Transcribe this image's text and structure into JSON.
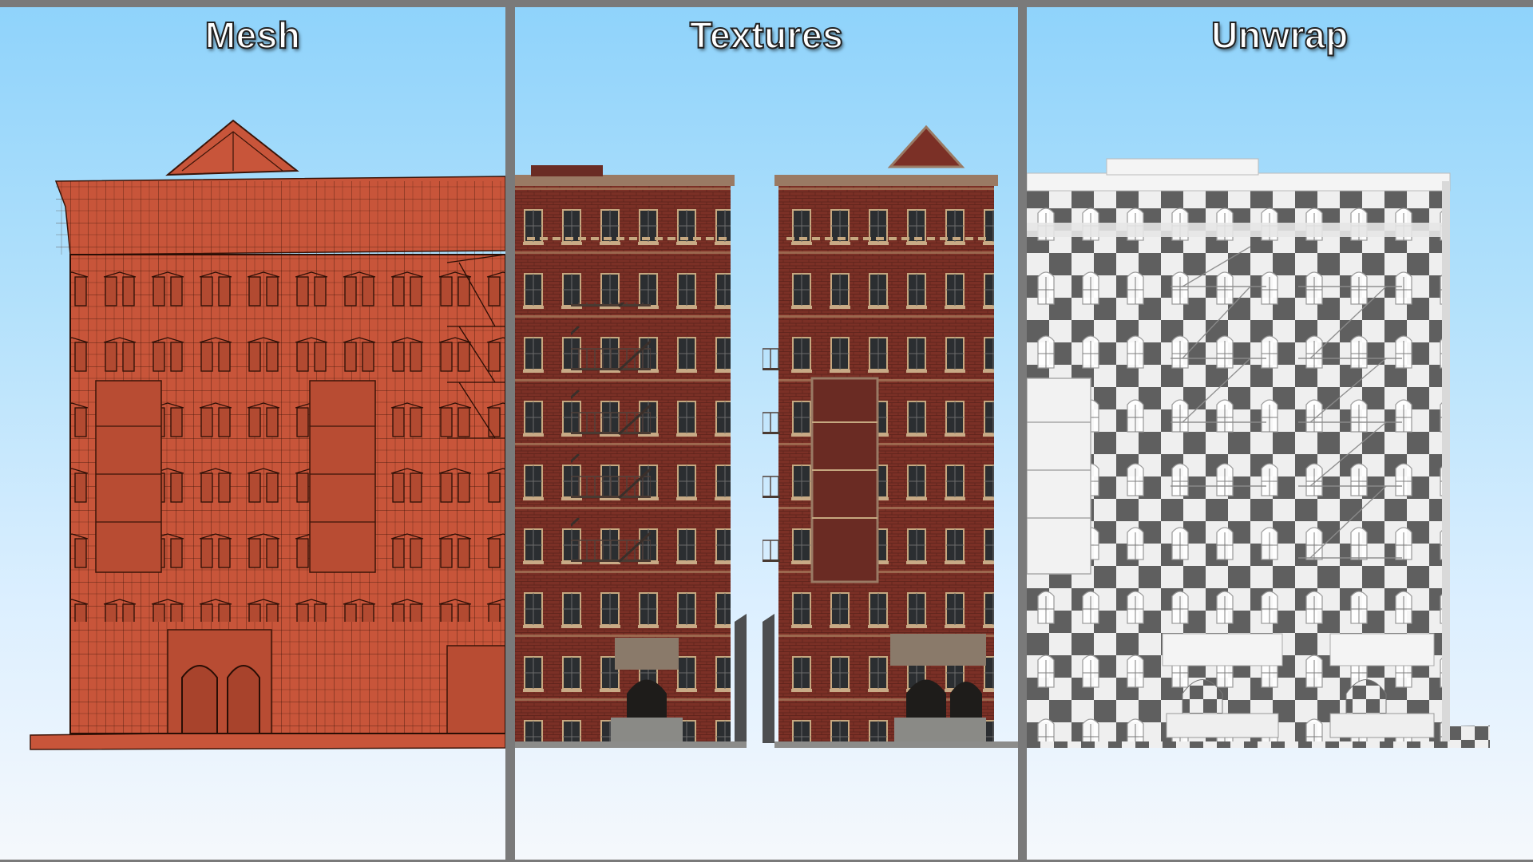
{
  "panels": [
    {
      "title": "Mesh"
    },
    {
      "title": "Textures"
    },
    {
      "title": "Unwrap"
    }
  ],
  "colors": {
    "frame": "#7a7a7a",
    "sky_top": "#8fd3fb",
    "sky_bottom": "#f5f8fc",
    "mesh_fill": "#c8553a",
    "mesh_line": "#3a1408",
    "brick": "#7b3026",
    "checker_dark": "#5f5f5f",
    "checker_light": "#efefef"
  }
}
